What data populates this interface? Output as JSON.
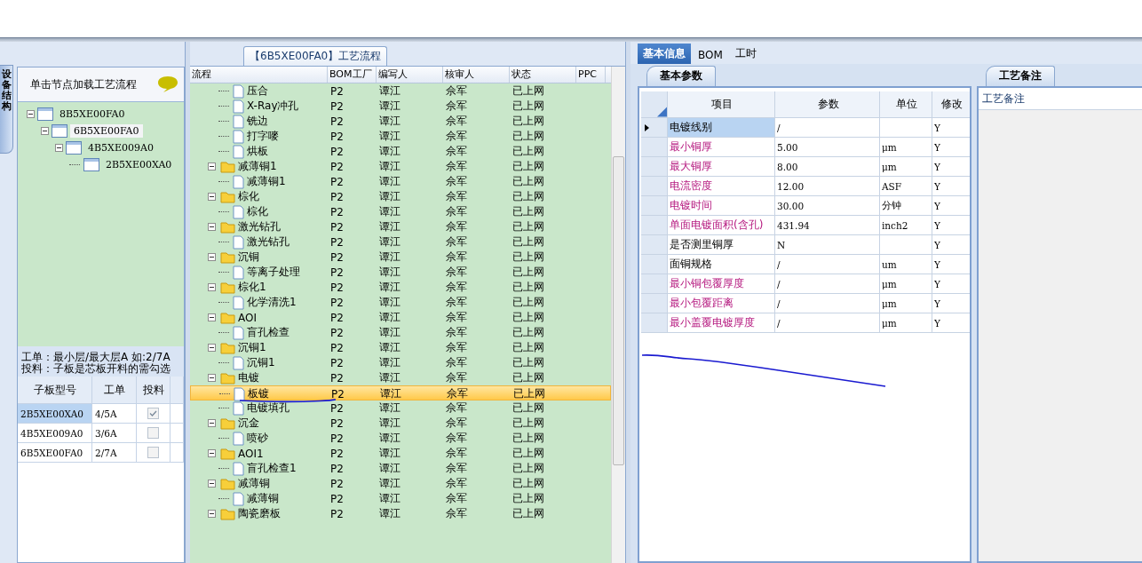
{
  "left_panel": {
    "side_tab": "设备结构",
    "hint": "单击节点加载工艺流程",
    "tree": [
      {
        "label": "8B5XE00FA0",
        "expanded": true,
        "selected": false,
        "children": [
          {
            "label": "6B5XE00FA0",
            "expanded": true,
            "selected": true,
            "children": [
              {
                "label": "4B5XE009A0",
                "expanded": true,
                "selected": false,
                "children": [
                  {
                    "label": "2B5XE00XA0",
                    "selected": false
                  }
                ]
              }
            ]
          }
        ]
      }
    ],
    "notes": [
      "工单：最小层/最大层A 如:2/7A",
      "投料：子板是芯板开料的需勾选"
    ],
    "columns": [
      "子板型号",
      "工单",
      "投料"
    ],
    "rows": [
      {
        "model": "2B5XE00XA0",
        "order": "4/5A",
        "checked": true,
        "selected": true
      },
      {
        "model": "4B5XE009A0",
        "order": "3/6A",
        "checked": false,
        "selected": false
      },
      {
        "model": "6B5XE00FA0",
        "order": "2/7A",
        "checked": false,
        "selected": false
      }
    ]
  },
  "process_panel": {
    "tab": "【6B5XE00FA0】工艺流程",
    "columns": [
      "流程",
      "BOM工厂",
      "编写人",
      "核审人",
      "状态",
      "PPC"
    ],
    "rows": [
      {
        "kind": "hidden-group",
        "children": [
          {
            "name": "压合",
            "factory": "P2",
            "writer": "谭江",
            "reviewer": "佘军",
            "status": "已上网",
            "selected": false
          },
          {
            "name": "X-Ray冲孔",
            "factory": "P2",
            "writer": "谭江",
            "reviewer": "佘军",
            "status": "已上网",
            "selected": false
          },
          {
            "name": "铣边",
            "factory": "P2",
            "writer": "谭江",
            "reviewer": "佘军",
            "status": "已上网",
            "selected": false
          },
          {
            "name": "打字嘜",
            "factory": "P2",
            "writer": "谭江",
            "reviewer": "佘军",
            "status": "已上网",
            "selected": false
          },
          {
            "name": "烘板",
            "factory": "P2",
            "writer": "谭江",
            "reviewer": "佘军",
            "status": "已上网",
            "selected": false
          }
        ]
      },
      {
        "kind": "group",
        "name": "减薄铜1",
        "factory": "P2",
        "writer": "谭江",
        "reviewer": "佘军",
        "status": "已上网",
        "selected": false,
        "children": [
          {
            "name": "减薄铜1",
            "factory": "P2",
            "writer": "谭江",
            "reviewer": "佘军",
            "status": "已上网",
            "selected": false
          }
        ]
      },
      {
        "kind": "group",
        "name": "棕化",
        "factory": "P2",
        "writer": "谭江",
        "reviewer": "佘军",
        "status": "已上网",
        "selected": false,
        "children": [
          {
            "name": "棕化",
            "factory": "P2",
            "writer": "谭江",
            "reviewer": "佘军",
            "status": "已上网",
            "selected": false
          }
        ]
      },
      {
        "kind": "group",
        "name": "激光钻孔",
        "factory": "P2",
        "writer": "谭江",
        "reviewer": "佘军",
        "status": "已上网",
        "selected": false,
        "children": [
          {
            "name": "激光钻孔",
            "factory": "P2",
            "writer": "谭江",
            "reviewer": "佘军",
            "status": "已上网",
            "selected": false
          }
        ]
      },
      {
        "kind": "group",
        "name": "沉铜",
        "factory": "P2",
        "writer": "谭江",
        "reviewer": "佘军",
        "status": "已上网",
        "selected": false,
        "children": [
          {
            "name": "等离子处理",
            "factory": "P2",
            "writer": "谭江",
            "reviewer": "佘军",
            "status": "已上网",
            "selected": false
          }
        ]
      },
      {
        "kind": "group",
        "name": "棕化1",
        "factory": "P2",
        "writer": "谭江",
        "reviewer": "佘军",
        "status": "已上网",
        "selected": false,
        "children": [
          {
            "name": "化学清洗1",
            "factory": "P2",
            "writer": "谭江",
            "reviewer": "佘军",
            "status": "已上网",
            "selected": false
          }
        ]
      },
      {
        "kind": "group",
        "name": "AOI",
        "factory": "P2",
        "writer": "谭江",
        "reviewer": "佘军",
        "status": "已上网",
        "selected": false,
        "children": [
          {
            "name": "盲孔检查",
            "factory": "P2",
            "writer": "谭江",
            "reviewer": "佘军",
            "status": "已上网",
            "selected": false
          }
        ]
      },
      {
        "kind": "group",
        "name": "沉铜1",
        "factory": "P2",
        "writer": "谭江",
        "reviewer": "佘军",
        "status": "已上网",
        "selected": false,
        "children": [
          {
            "name": "沉铜1",
            "factory": "P2",
            "writer": "谭江",
            "reviewer": "佘军",
            "status": "已上网",
            "selected": false
          }
        ]
      },
      {
        "kind": "group",
        "name": "电镀",
        "factory": "P2",
        "writer": "谭江",
        "reviewer": "佘军",
        "status": "已上网",
        "selected": false,
        "children": [
          {
            "name": "板镀",
            "factory": "P2",
            "writer": "谭江",
            "reviewer": "佘军",
            "status": "已上网",
            "selected": true
          },
          {
            "name": "电镀填孔",
            "factory": "P2",
            "writer": "谭江",
            "reviewer": "佘军",
            "status": "已上网",
            "selected": false
          }
        ]
      },
      {
        "kind": "group",
        "name": "沉金",
        "factory": "P2",
        "writer": "谭江",
        "reviewer": "佘军",
        "status": "已上网",
        "selected": false,
        "children": [
          {
            "name": "喷砂",
            "factory": "P2",
            "writer": "谭江",
            "reviewer": "佘军",
            "status": "已上网",
            "selected": false
          }
        ]
      },
      {
        "kind": "group",
        "name": "AOI1",
        "factory": "P2",
        "writer": "谭江",
        "reviewer": "佘军",
        "status": "已上网",
        "selected": false,
        "children": [
          {
            "name": "盲孔检查1",
            "factory": "P2",
            "writer": "谭江",
            "reviewer": "佘军",
            "status": "已上网",
            "selected": false
          }
        ]
      },
      {
        "kind": "group",
        "name": "减薄铜",
        "factory": "P2",
        "writer": "谭江",
        "reviewer": "佘军",
        "status": "已上网",
        "selected": false,
        "children": [
          {
            "name": "减薄铜",
            "factory": "P2",
            "writer": "谭江",
            "reviewer": "佘军",
            "status": "已上网",
            "selected": false
          }
        ]
      },
      {
        "kind": "group",
        "name": "陶瓷磨板",
        "factory": "P2",
        "writer": "谭江",
        "reviewer": "佘军",
        "status": "已上网",
        "selected": false
      }
    ]
  },
  "detail_panel": {
    "tabs": [
      {
        "label": "基本信息",
        "selected": true
      },
      {
        "label": "BOM",
        "selected": false
      },
      {
        "label": "工时",
        "selected": false
      }
    ],
    "params_tab": "基本参数",
    "columns": [
      "项目",
      "参数",
      "单位",
      "修改"
    ],
    "rows": [
      {
        "item": "电镀线别",
        "value": "/",
        "modify": "Y",
        "kind": "plain",
        "selected": true
      },
      {
        "item": "最小铜厚",
        "value": "5.00",
        "unit": "μm",
        "modify": "Y",
        "kind": "required",
        "selected": false
      },
      {
        "item": "最大铜厚",
        "value": "8.00",
        "unit": "μm",
        "modify": "Y",
        "kind": "required",
        "selected": false
      },
      {
        "item": "电流密度",
        "value": "12.00",
        "unit": "ASF",
        "modify": "Y",
        "kind": "required",
        "selected": false
      },
      {
        "item": "电镀时间",
        "value": "30.00",
        "unit": "分钟",
        "modify": "Y",
        "kind": "required",
        "selected": false
      },
      {
        "item": "单面电镀面积(含孔)",
        "value": "431.94",
        "unit": "inch2",
        "modify": "Y",
        "kind": "required",
        "selected": false
      },
      {
        "item": "是否测里铜厚",
        "value": "N",
        "modify": "Y",
        "kind": "plain",
        "selected": false
      },
      {
        "item": "面铜规格",
        "value": "/",
        "unit": "um",
        "modify": "Y",
        "kind": "plain",
        "selected": false
      },
      {
        "item": "最小铜包覆厚度",
        "value": "/",
        "unit": "μm",
        "modify": "Y",
        "kind": "required",
        "selected": false
      },
      {
        "item": "最小包覆距离",
        "value": "/",
        "unit": "μm",
        "modify": "Y",
        "kind": "required",
        "selected": false
      },
      {
        "item": "最小盖覆电镀厚度",
        "value": "/",
        "unit": "μm",
        "modify": "Y",
        "kind": "required",
        "selected": false
      }
    ],
    "remarks_tab": "工艺备注",
    "remarks_label": "工艺备注"
  }
}
